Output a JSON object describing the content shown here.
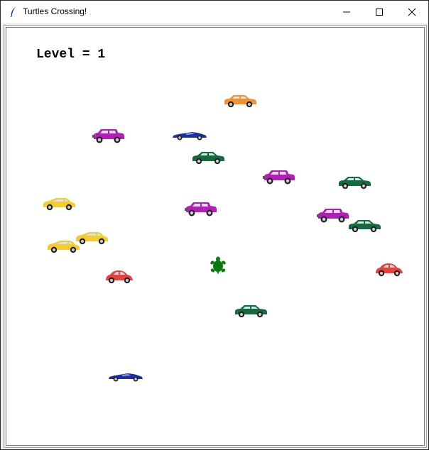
{
  "window": {
    "title": "Turtles Crossing!"
  },
  "scoreboard": {
    "level_label": "Level = 1"
  },
  "icons": {
    "app": "feather-icon",
    "minimize": "minimize-icon",
    "maximize": "maximize-icon",
    "close": "close-icon",
    "player": "turtle-icon"
  },
  "colors": {
    "player_turtle": "#0b7a0b",
    "car_orange": "#f2922e",
    "car_magenta": "#b01fb6",
    "car_green": "#156b3d",
    "car_yellow": "#f4cc2e",
    "car_red": "#e8403c",
    "car_blue": "#1d2fa8"
  },
  "cars": [
    {
      "kind": "sedan",
      "color": "orange"
    },
    {
      "kind": "suv",
      "color": "magenta"
    },
    {
      "kind": "sports",
      "color": "blue"
    },
    {
      "kind": "sedan",
      "color": "green"
    },
    {
      "kind": "suv",
      "color": "magenta"
    },
    {
      "kind": "sedan",
      "color": "green"
    },
    {
      "kind": "hatch",
      "color": "yellow"
    },
    {
      "kind": "suv",
      "color": "magenta"
    },
    {
      "kind": "suv",
      "color": "magenta"
    },
    {
      "kind": "sedan",
      "color": "green"
    },
    {
      "kind": "hatch",
      "color": "yellow"
    },
    {
      "kind": "hatch",
      "color": "yellow"
    },
    {
      "kind": "beetle",
      "color": "red"
    },
    {
      "kind": "beetle",
      "color": "red"
    },
    {
      "kind": "sedan",
      "color": "green"
    },
    {
      "kind": "sports",
      "color": "blue"
    }
  ]
}
